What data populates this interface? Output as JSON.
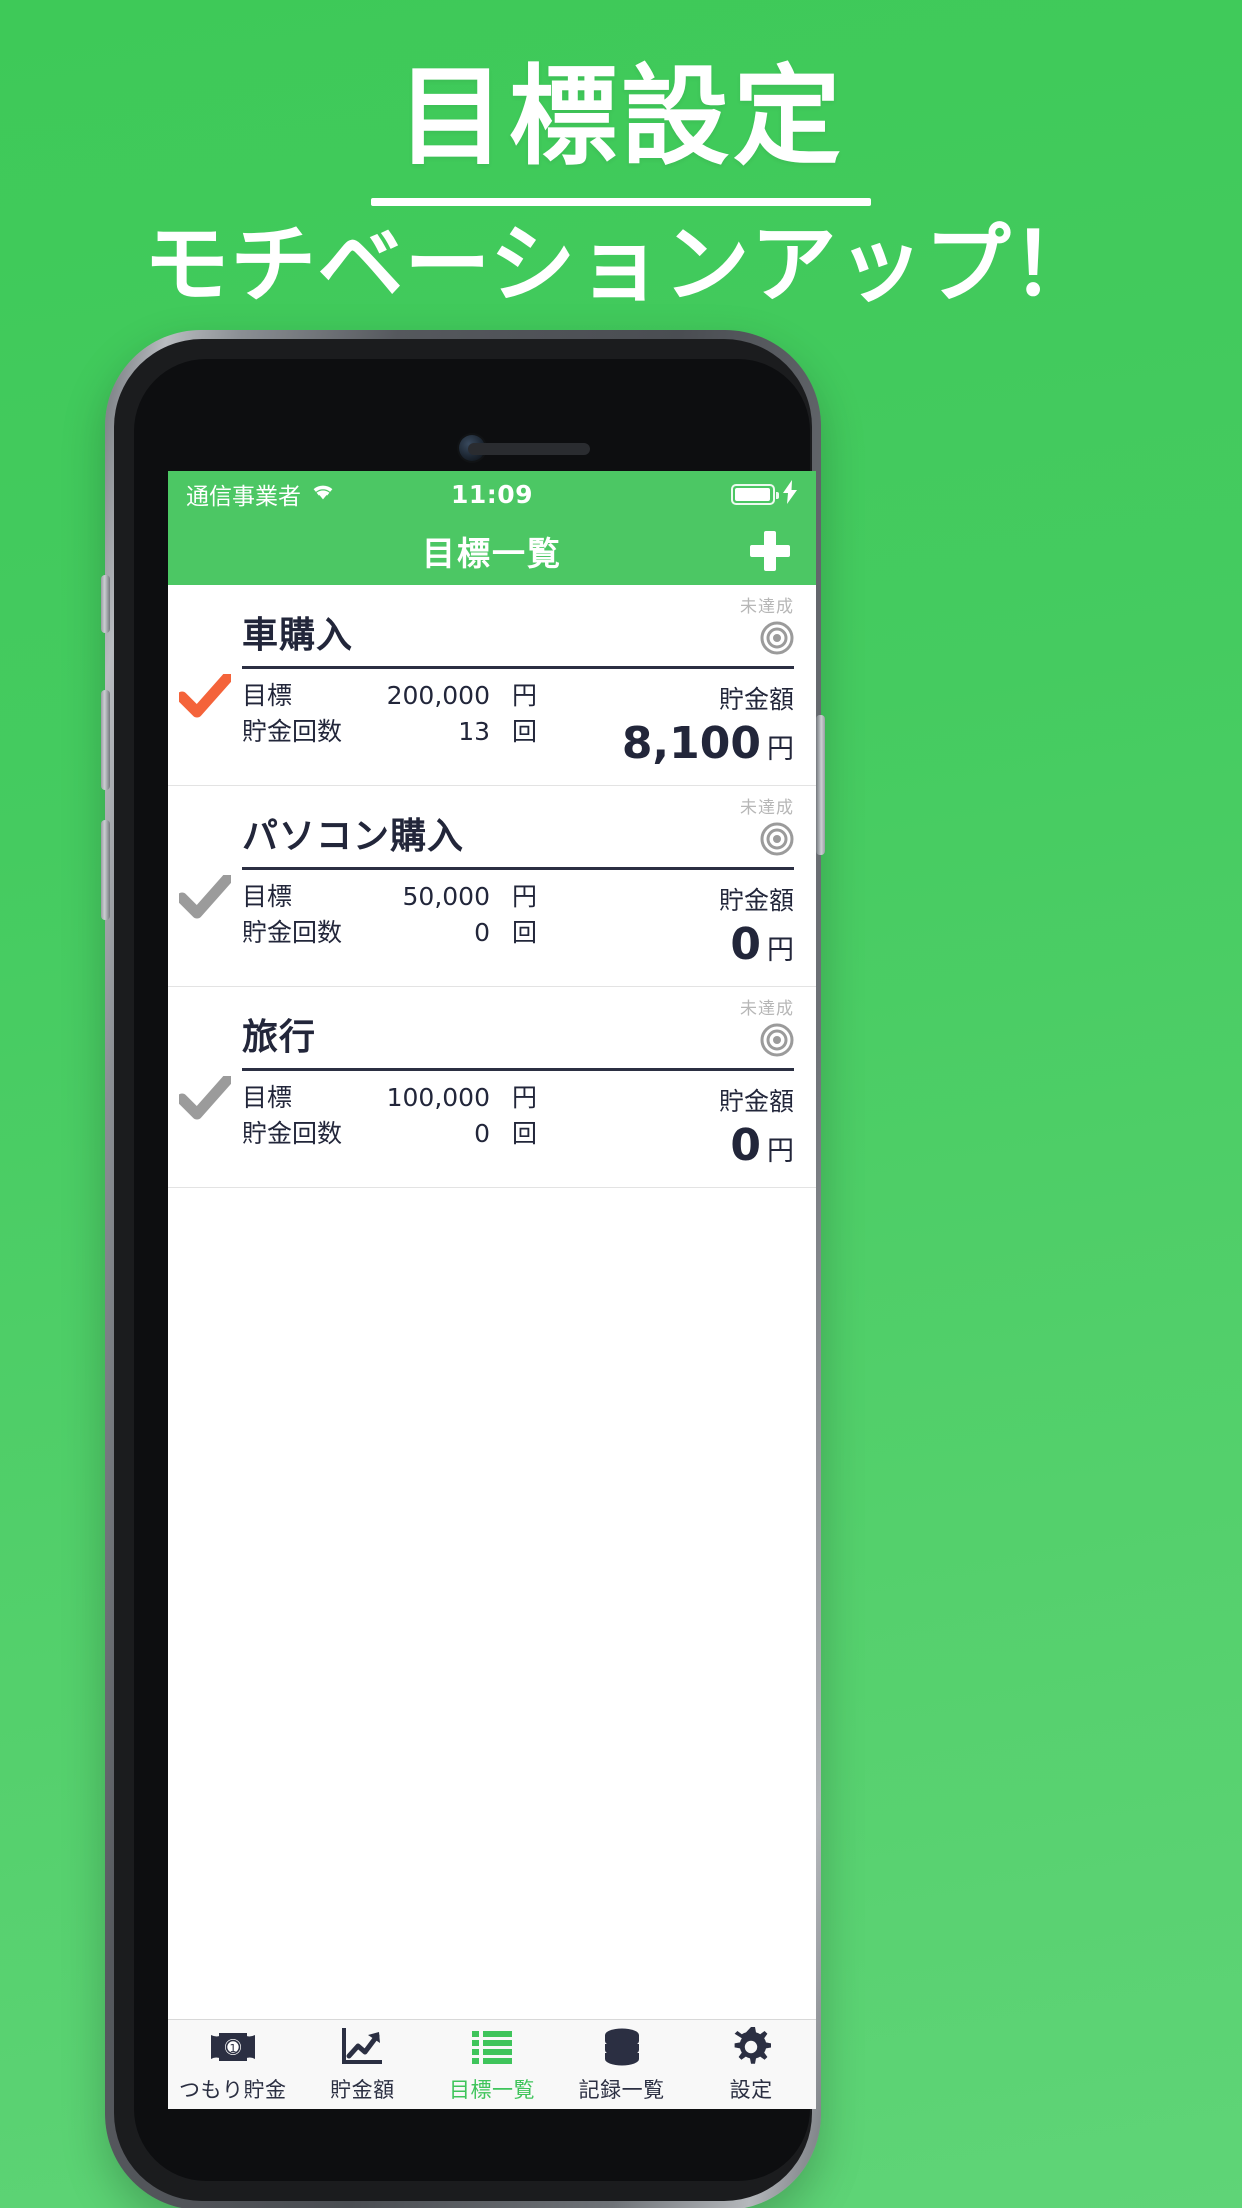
{
  "promo": {
    "title": "目標設定",
    "subtitle": "モチベーションアップ！"
  },
  "colors": {
    "brand_green": "#4CC764",
    "background_green": "#45cb60",
    "accent_orange": "#f4633a",
    "inactive_gray": "#9b9b9b",
    "text_dark": "#22263a"
  },
  "status_bar": {
    "carrier": "通信事業者",
    "wifi_icon": "wifi-icon",
    "time": "11:09",
    "battery_icon": "battery-icon",
    "charging_icon": "lightning-bolt-icon"
  },
  "navbar": {
    "title": "目標一覧",
    "add_icon": "plus-icon"
  },
  "goals": {
    "labels": {
      "target": "目標",
      "count": "貯金回数",
      "unit_yen": "円",
      "unit_times": "回",
      "saved_label": "貯金額",
      "saved_unit": "円",
      "status_unachieved": "未達成"
    },
    "items": [
      {
        "name": "車購入",
        "check_state": "achieved",
        "status": "未達成",
        "status_icon": "target-bullseye-icon",
        "target_amount": "200,000",
        "target_unit": "円",
        "save_count": "13",
        "count_unit": "回",
        "saved_label": "貯金額",
        "saved_amount": "8,100",
        "saved_unit": "円"
      },
      {
        "name": "パソコン購入",
        "check_state": "pending",
        "status": "未達成",
        "status_icon": "target-bullseye-icon",
        "target_amount": "50,000",
        "target_unit": "円",
        "save_count": "0",
        "count_unit": "回",
        "saved_label": "貯金額",
        "saved_amount": "0",
        "saved_unit": "円"
      },
      {
        "name": "旅行",
        "check_state": "pending",
        "status": "未達成",
        "status_icon": "target-bullseye-icon",
        "target_amount": "100,000",
        "target_unit": "円",
        "save_count": "0",
        "count_unit": "回",
        "saved_label": "貯金額",
        "saved_amount": "0",
        "saved_unit": "円"
      }
    ]
  },
  "tabbar": {
    "items": [
      {
        "label": "つもり貯金",
        "icon": "banknote-icon",
        "active": false
      },
      {
        "label": "貯金額",
        "icon": "line-chart-icon",
        "active": false
      },
      {
        "label": "目標一覧",
        "icon": "list-icon",
        "active": true
      },
      {
        "label": "記録一覧",
        "icon": "database-icon",
        "active": false
      },
      {
        "label": "設定",
        "icon": "gear-icon",
        "active": false
      }
    ]
  }
}
